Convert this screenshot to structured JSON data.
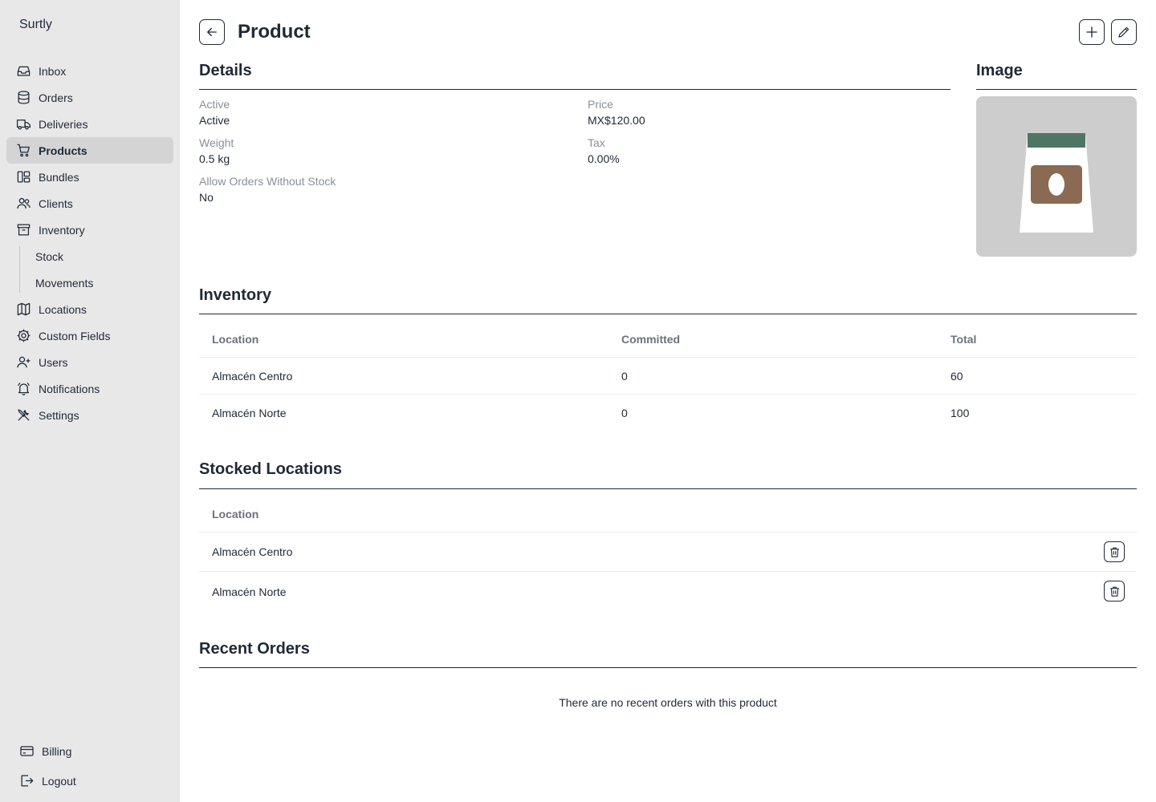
{
  "app": {
    "name": "Surtly"
  },
  "sidebar": {
    "items": [
      {
        "label": "Inbox",
        "icon": "inbox-icon"
      },
      {
        "label": "Orders",
        "icon": "database-icon"
      },
      {
        "label": "Deliveries",
        "icon": "truck-icon"
      },
      {
        "label": "Products",
        "icon": "cart-icon",
        "active": true
      },
      {
        "label": "Bundles",
        "icon": "bundles-icon"
      },
      {
        "label": "Clients",
        "icon": "users-icon"
      },
      {
        "label": "Inventory",
        "icon": "archive-icon"
      }
    ],
    "inventory_sub": [
      {
        "label": "Stock"
      },
      {
        "label": "Movements"
      }
    ],
    "items_after": [
      {
        "label": "Locations",
        "icon": "map-icon"
      },
      {
        "label": "Custom Fields",
        "icon": "cog-icon"
      },
      {
        "label": "Users",
        "icon": "user-plus-icon"
      },
      {
        "label": "Notifications",
        "icon": "bell-icon"
      },
      {
        "label": "Settings",
        "icon": "tools-icon"
      }
    ],
    "bottom": [
      {
        "label": "Billing",
        "icon": "credit-card-icon"
      },
      {
        "label": "Logout",
        "icon": "logout-icon"
      }
    ]
  },
  "header": {
    "title": "Product"
  },
  "details": {
    "title": "Details",
    "fields": {
      "active": {
        "label": "Active",
        "value": "Active"
      },
      "price": {
        "label": "Price",
        "value": "MX$120.00"
      },
      "weight": {
        "label": "Weight",
        "value": "0.5 kg"
      },
      "tax": {
        "label": "Tax",
        "value": "0.00%"
      },
      "allow_orders": {
        "label": "Allow Orders Without Stock",
        "value": "No"
      }
    }
  },
  "image": {
    "title": "Image",
    "colors": {
      "background": "#cdcdcd",
      "bag": "#ffffff",
      "band": "#4f7565",
      "label": "#8b6a53"
    }
  },
  "inventory": {
    "title": "Inventory",
    "columns": [
      "Location",
      "Committed",
      "Total"
    ],
    "rows": [
      {
        "location": "Almacén Centro",
        "committed": "0",
        "total": "60"
      },
      {
        "location": "Almacén Norte",
        "committed": "0",
        "total": "100"
      }
    ]
  },
  "stocked_locations": {
    "title": "Stocked Locations",
    "column": "Location",
    "rows": [
      {
        "location": "Almacén Centro"
      },
      {
        "location": "Almacén Norte"
      }
    ]
  },
  "recent_orders": {
    "title": "Recent Orders",
    "empty_message": "There are no recent orders with this product"
  }
}
